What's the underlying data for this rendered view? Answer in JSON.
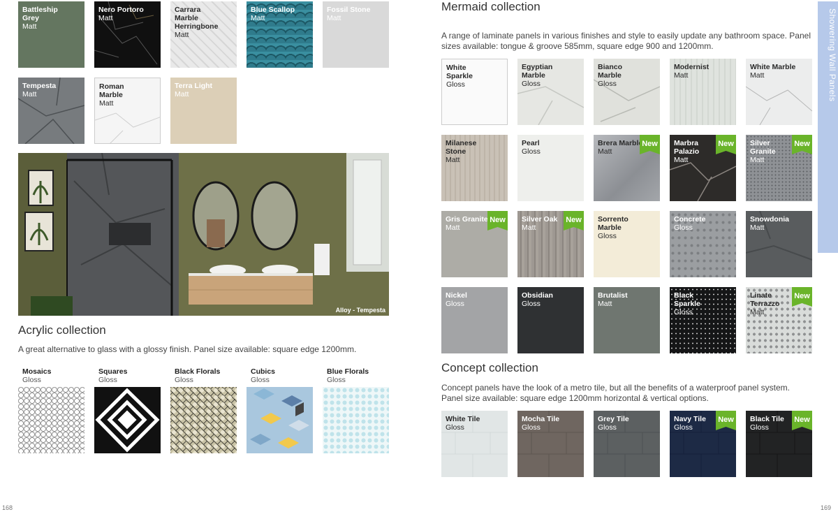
{
  "side_tab": {
    "text": "Showering   Wall Panels"
  },
  "page_numbers": {
    "left": "168",
    "right": "169"
  },
  "top_swatches": [
    {
      "name": "Battleship Grey",
      "finish": "Matt"
    },
    {
      "name": "Nero Portoro",
      "finish": "Matt"
    },
    {
      "name": "Carrara Marble Herringbone",
      "finish": "Matt"
    },
    {
      "name": "Blue Scallop",
      "finish": "Matt"
    },
    {
      "name": "Fossil Stone",
      "finish": "Matt"
    },
    {
      "name": "Tempesta",
      "finish": "Matt"
    },
    {
      "name": "Roman Marble",
      "finish": "Matt"
    },
    {
      "name": "Terra Light",
      "finish": "Matt"
    }
  ],
  "photo": {
    "caption": "Alloy - Tempesta"
  },
  "acrylic": {
    "title": "Acrylic collection",
    "description": "A great alternative to glass with a glossy finish. Panel size available: square edge 1200mm.",
    "swatches": [
      {
        "name": "Mosaics",
        "finish": "Gloss"
      },
      {
        "name": "Squares",
        "finish": "Gloss"
      },
      {
        "name": "Black Florals",
        "finish": "Gloss"
      },
      {
        "name": "Cubics",
        "finish": "Gloss"
      },
      {
        "name": "Blue Florals",
        "finish": "Gloss"
      }
    ]
  },
  "mermaid": {
    "title": "Mermaid collection",
    "description_line1": "A range of laminate panels in various finishes and style to easily update any bathroom space. Panel",
    "description_line2": "sizes available: tongue & groove 585mm, square edge 900 and 1200mm.",
    "new_label": "New",
    "swatches": [
      {
        "name": "White Sparkle",
        "finish": "Gloss"
      },
      {
        "name": "Egyptian Marble",
        "finish": "Gloss"
      },
      {
        "name": "Bianco Marble",
        "finish": "Gloss"
      },
      {
        "name": "Modernist",
        "finish": "Matt"
      },
      {
        "name": "White Marble",
        "finish": "Matt"
      },
      {
        "name": "Milanese Stone",
        "finish": "Matt"
      },
      {
        "name": "Pearl",
        "finish": "Gloss"
      },
      {
        "name": "Brera Marble",
        "finish": "Matt",
        "is_new": true
      },
      {
        "name": "Marbra Palazio",
        "finish": "Matt",
        "is_new": true
      },
      {
        "name": "Silver Granite",
        "finish": "Matt",
        "is_new": true
      },
      {
        "name": "Gris Granite",
        "finish": "Matt",
        "is_new": true
      },
      {
        "name": "Silver Oak",
        "finish": "Matt",
        "is_new": true
      },
      {
        "name": "Sorrento Marble",
        "finish": "Gloss"
      },
      {
        "name": "Concrete",
        "finish": "Gloss"
      },
      {
        "name": "Snowdonia",
        "finish": "Matt"
      },
      {
        "name": "Nickel",
        "finish": "Gloss"
      },
      {
        "name": "Obsidian",
        "finish": "Gloss"
      },
      {
        "name": "Brutalist",
        "finish": "Matt"
      },
      {
        "name": "Black Sparkle",
        "finish": "Gloss"
      },
      {
        "name": "Linate Terrazzo",
        "finish": "Matt",
        "is_new": true
      }
    ]
  },
  "concept": {
    "title": "Concept collection",
    "description_line1": "Concept panels have the look of a metro tile, but all the benefits of a waterproof panel system.",
    "description_line2": "Panel size available: square edge 1200mm horizontal & vertical options.",
    "new_label": "New",
    "swatches": [
      {
        "name": "White Tile",
        "finish": "Gloss"
      },
      {
        "name": "Mocha Tile",
        "finish": "Gloss"
      },
      {
        "name": "Grey Tile",
        "finish": "Gloss"
      },
      {
        "name": "Navy Tile",
        "finish": "Gloss",
        "is_new": true
      },
      {
        "name": "Black Tile",
        "finish": "Gloss",
        "is_new": true
      }
    ]
  },
  "colors": {
    "accent_tab": "#b6c9ea",
    "new_badge": "#6ab42a"
  }
}
